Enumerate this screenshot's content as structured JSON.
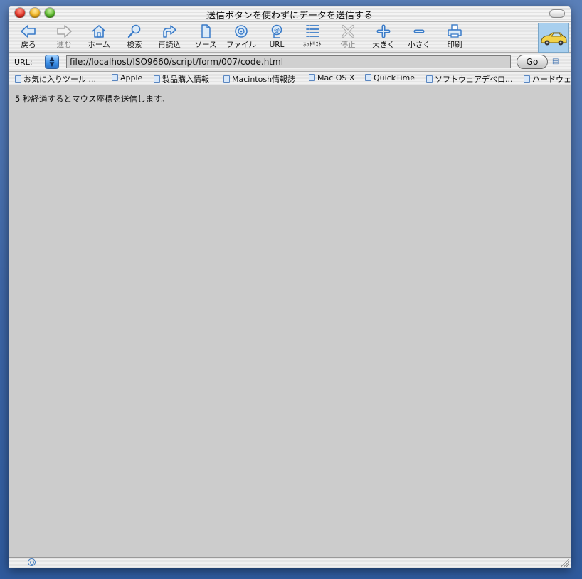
{
  "window": {
    "title": "送信ボタンを使わずにデータを送信する"
  },
  "toolbar": {
    "buttons": [
      {
        "label": "戻る",
        "icon": "back-arrow-icon"
      },
      {
        "label": "進む",
        "icon": "forward-arrow-icon",
        "disabled": true
      },
      {
        "label": "ホーム",
        "icon": "home-icon"
      },
      {
        "label": "検索",
        "icon": "search-icon"
      },
      {
        "label": "再読込",
        "icon": "reload-icon"
      },
      {
        "label": "ソース",
        "icon": "source-page-icon"
      },
      {
        "label": "ファイル",
        "icon": "file-disc-icon"
      },
      {
        "label": "URL",
        "icon": "url-icon"
      },
      {
        "label": "ﾎｯﾄﾘｽﾄ",
        "icon": "hotlist-icon"
      },
      {
        "label": "停止",
        "icon": "stop-icon",
        "disabled": true
      },
      {
        "label": "大きく",
        "icon": "zoom-in-icon"
      },
      {
        "label": "小さく",
        "icon": "zoom-out-icon"
      },
      {
        "label": "印刷",
        "icon": "print-icon"
      }
    ]
  },
  "urlbar": {
    "label": "URL:",
    "value": "file://localhost/ISO9660/script/form/007/code.html",
    "go_label": "Go"
  },
  "favorites": [
    "お気に入りツール ...",
    "Apple",
    "製品購入情報",
    "Macintosh情報誌",
    "Mac OS X",
    "QuickTime",
    "ソフトウェアデベロ...",
    "ハードウェ"
  ],
  "content": {
    "message": "5 秒経過するとマウス座標を送信します。"
  },
  "colors": {
    "accent": "#3a8ee6",
    "content_bg": "#cccccc"
  }
}
